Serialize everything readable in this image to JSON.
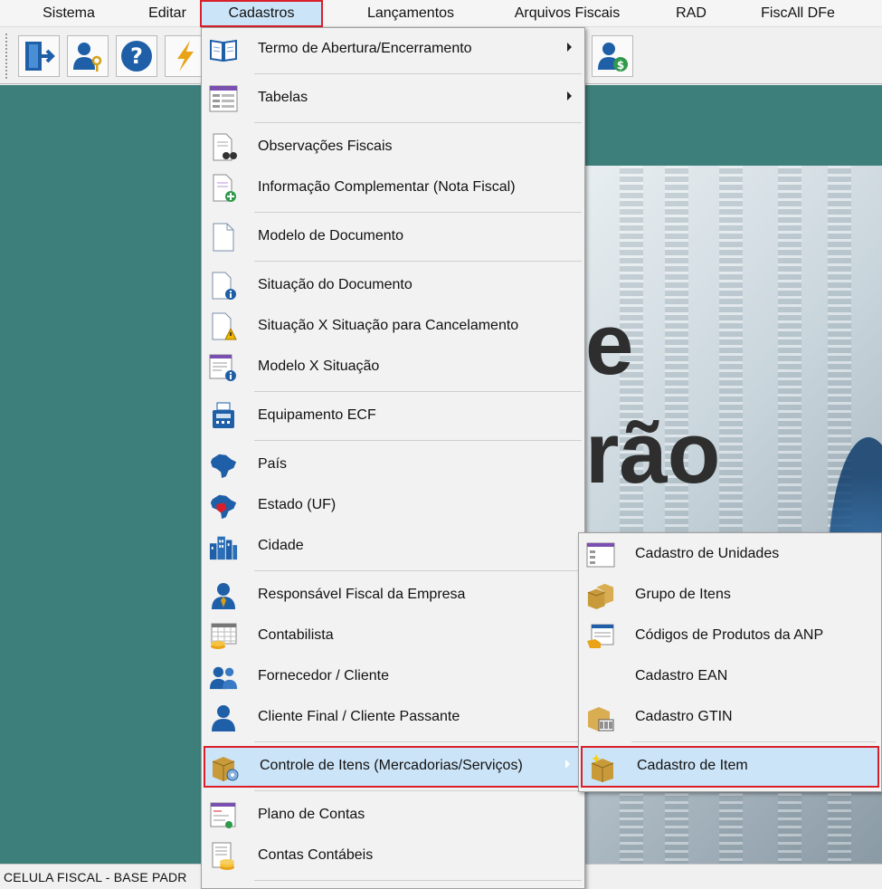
{
  "menubar": {
    "items": [
      "Sistema",
      "Editar",
      "Cadastros",
      "Lançamentos",
      "Arquivos Fiscais",
      "RAD",
      "FiscAll DFe"
    ]
  },
  "toolbar": {
    "buttons": [
      "exit-icon",
      "user-key-icon",
      "help-icon",
      "lightning-icon",
      "user-money-icon"
    ]
  },
  "splash": {
    "text_line1": "e",
    "text_line2": "rão"
  },
  "cadastros_menu": {
    "items": [
      {
        "label": "Termo de Abertura/Encerramento",
        "icon": "book-icon",
        "submenu": true
      },
      {
        "label": "Tabelas",
        "icon": "table-list-icon",
        "submenu": true
      },
      {
        "label": "Observações Fiscais",
        "icon": "document-binoculars-icon"
      },
      {
        "label": "Informação Complementar (Nota Fiscal)",
        "icon": "document-add-icon"
      },
      {
        "label": "Modelo de Documento",
        "icon": "blank-document-icon"
      },
      {
        "label": "Situação do Documento",
        "icon": "document-info-icon"
      },
      {
        "label": "Situação X Situação para Cancelamento",
        "icon": "document-warning-icon"
      },
      {
        "label": "Modelo X Situação",
        "icon": "form-info-icon"
      },
      {
        "label": "Equipamento ECF",
        "icon": "cash-register-icon"
      },
      {
        "label": "País",
        "icon": "brazil-map-icon"
      },
      {
        "label": "Estado (UF)",
        "icon": "brazil-state-map-icon"
      },
      {
        "label": "Cidade",
        "icon": "city-buildings-icon"
      },
      {
        "label": "Responsável Fiscal da Empresa",
        "icon": "person-tie-icon"
      },
      {
        "label": "Contabilista",
        "icon": "calendar-coins-icon"
      },
      {
        "label": "Fornecedor / Cliente",
        "icon": "people-group-icon"
      },
      {
        "label": "Cliente Final / Cliente Passante",
        "icon": "person-icon"
      },
      {
        "label": "Controle de Itens (Mercadorias/Serviços)",
        "icon": "box-gear-icon",
        "submenu": true
      },
      {
        "label": "Plano de Contas",
        "icon": "chart-of-accounts-icon"
      },
      {
        "label": "Contas Contábeis",
        "icon": "ledger-coins-icon"
      }
    ]
  },
  "itens_submenu": {
    "items": [
      {
        "label": "Cadastro de Unidades",
        "icon": "window-units-icon"
      },
      {
        "label": "Grupo de Itens",
        "icon": "boxes-icon"
      },
      {
        "label": "Códigos de Produtos da ANP",
        "icon": "table-hand-icon"
      },
      {
        "label": "Cadastro EAN",
        "icon": ""
      },
      {
        "label": "Cadastro GTIN",
        "icon": "box-barcode-icon"
      },
      {
        "label": "Cadastro de Item",
        "icon": "box-sparkle-icon"
      }
    ]
  },
  "statusbar": {
    "text": "CELULA FISCAL - BASE PADR"
  },
  "colors": {
    "desktop": "#3d7f7a",
    "highlight_border": "#d9202a",
    "highlight_fill": "#cce4f7",
    "icon_blue": "#1f5fa8"
  }
}
